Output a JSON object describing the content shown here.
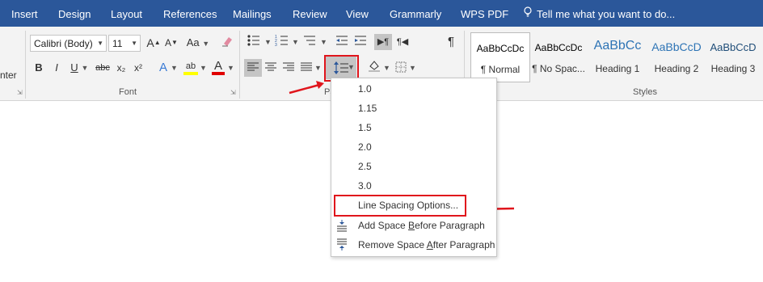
{
  "tabs": [
    "Insert",
    "Design",
    "Layout",
    "References",
    "Mailings",
    "Review",
    "View",
    "Grammarly",
    "WPS PDF"
  ],
  "tell_me": "Tell me what you want to do...",
  "font": {
    "name": "Calibri (Body)",
    "size": "11",
    "group_label": "Font",
    "bold": "B",
    "italic": "I",
    "underline": "U",
    "strike": "abc",
    "subscript": "x₂",
    "superscript": "x²",
    "grow": "A",
    "shrink": "A",
    "change_case": "Aa",
    "text_effects": "A",
    "highlight": "ab",
    "font_color": "A"
  },
  "clipboard_partial": "nter",
  "paragraph_label_partial": "Pa",
  "styles": {
    "group_label": "Styles",
    "items": [
      {
        "preview": "AaBbCcDc",
        "name": "¶ Normal",
        "color": "#000000"
      },
      {
        "preview": "AaBbCcDc",
        "name": "¶ No Spac...",
        "color": "#000000"
      },
      {
        "preview": "AaBbCc",
        "name": "Heading 1",
        "color": "#2e74b5"
      },
      {
        "preview": "AaBbCcD",
        "name": "Heading 2",
        "color": "#2e74b5"
      },
      {
        "preview": "AaBbCcD",
        "name": "Heading 3",
        "color": "#1f4d78"
      }
    ]
  },
  "line_spacing_menu": {
    "options": [
      "1.0",
      "1.15",
      "1.5",
      "2.0",
      "2.5",
      "3.0"
    ],
    "line_spacing_options": "Line Spacing Options...",
    "add_space_pre": "Add Space ",
    "add_space_key": "B",
    "add_space_post": "efore Paragraph",
    "remove_space_pre": "Remove Space ",
    "remove_space_key": "A",
    "remove_space_post": "fter Paragraph"
  },
  "colors": {
    "brand": "#2b579a",
    "annotation": "#e0151c",
    "highlight_yellow": "#ffff00",
    "font_red": "#e00000"
  }
}
